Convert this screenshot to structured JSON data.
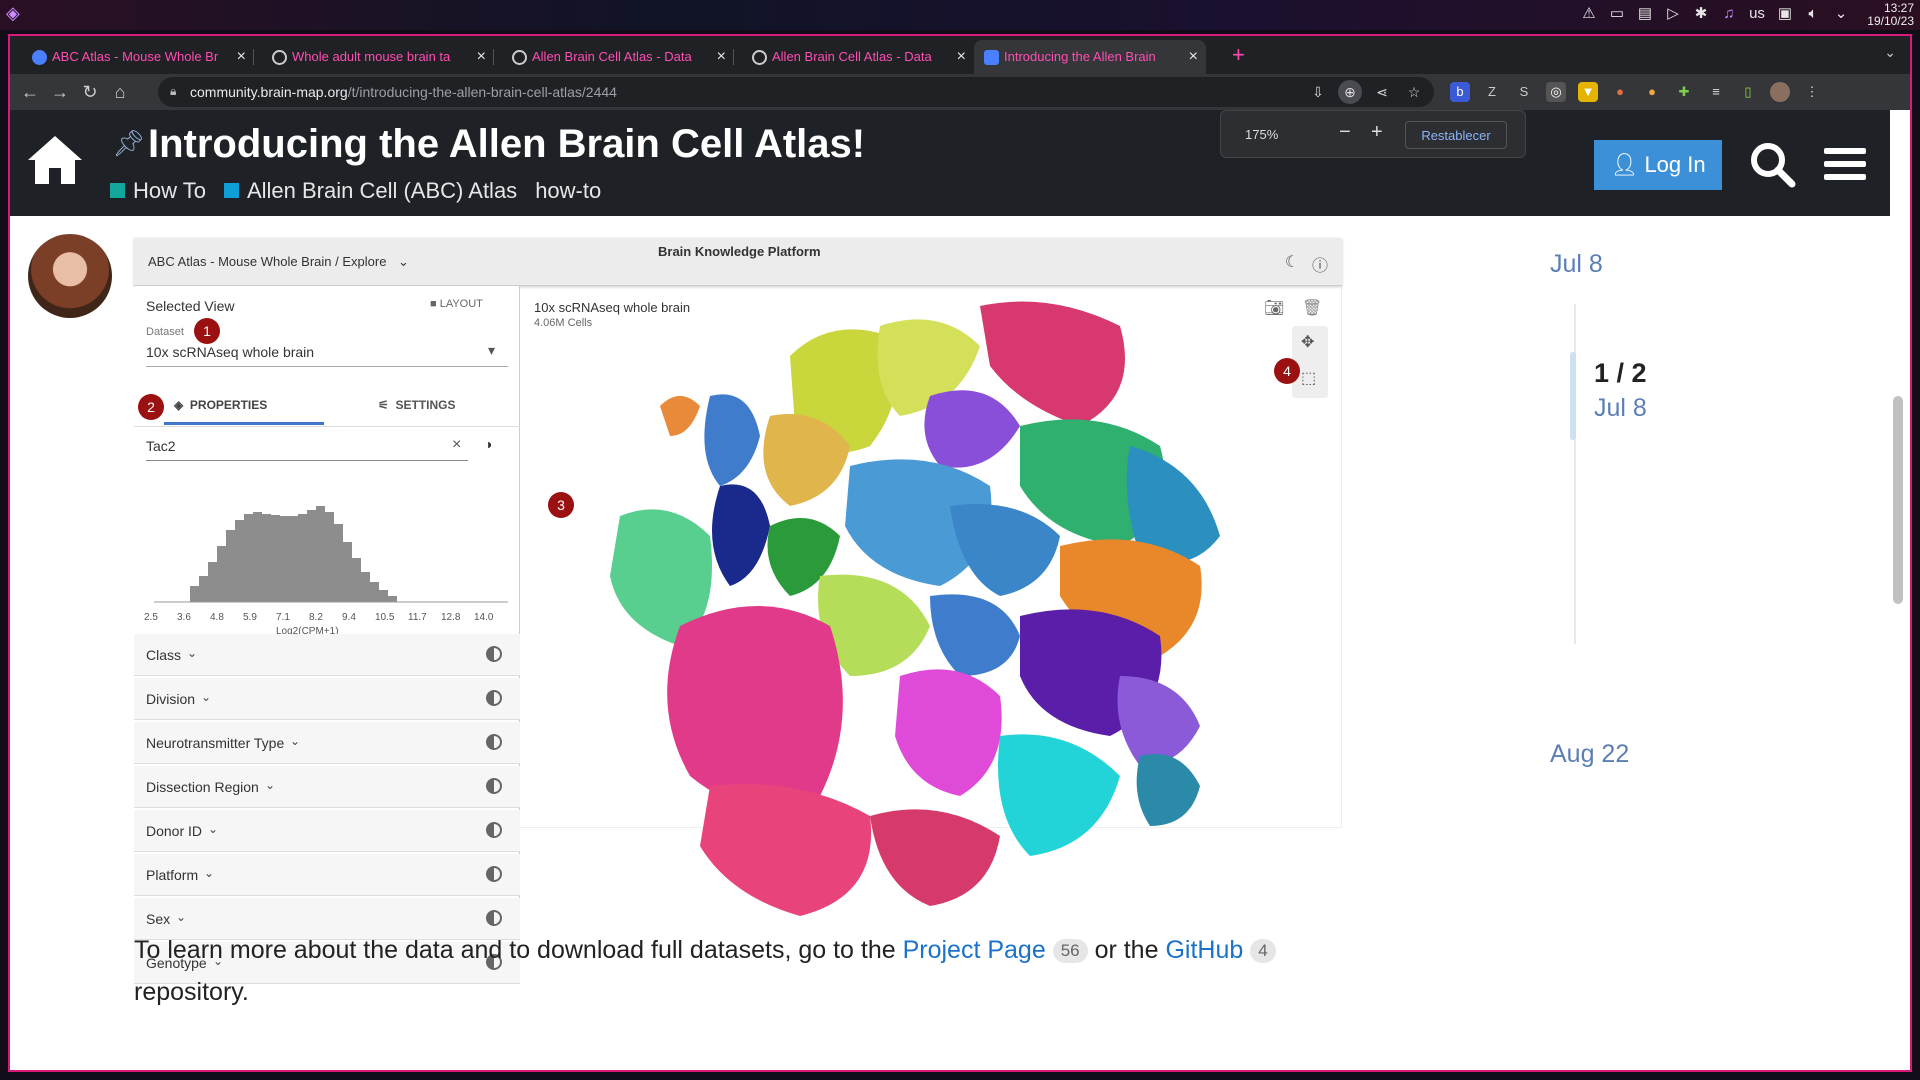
{
  "os": {
    "tray_lang": "us",
    "clock_time": "13:27",
    "clock_date": "19/10/23"
  },
  "browser": {
    "tabs": [
      {
        "label": "ABC Atlas - Mouse Whole Br"
      },
      {
        "label": "Whole adult mouse brain ta"
      },
      {
        "label": "Allen Brain Cell Atlas - Data"
      },
      {
        "label": "Allen Brain Cell Atlas - Data"
      },
      {
        "label": "Introducing the Allen Brain"
      }
    ],
    "url_host": "community.brain-map.org",
    "url_path": "/t/introducing-the-allen-brain-cell-atlas/2444",
    "zoom": {
      "value": "175%",
      "minus": "−",
      "plus": "+",
      "reset": "Restablecer"
    }
  },
  "site": {
    "title": "Introducing the Allen Brain Cell Atlas!",
    "categories": [
      {
        "label": "How To",
        "color": "#12a89d"
      },
      {
        "label": "Allen Brain Cell (ABC) Atlas",
        "color": "#0e9fd6"
      },
      {
        "label": "how-to",
        "color": ""
      }
    ],
    "login": "Log In"
  },
  "embedded": {
    "breadcrumb": "ABC Atlas - Mouse Whole Brain  /  Explore",
    "platform_title": "Brain Knowledge Platform",
    "selected_view": "Selected View",
    "layout": "LAYOUT",
    "dataset_label": "Dataset",
    "dataset_value": "10x scRNAseq whole brain",
    "tab_properties": "PROPERTIES",
    "tab_settings": "SETTINGS",
    "gene": "Tac2",
    "histogram": {
      "ticks": [
        "2.5",
        "3.6",
        "4.8",
        "5.9",
        "7.1",
        "8.2",
        "9.4",
        "10.5",
        "11.7",
        "12.8",
        "14.0"
      ],
      "xlabel": "Log2(CPM+1)"
    },
    "properties": [
      "Class",
      "Division",
      "Neurotransmitter Type",
      "Dissection Region",
      "Donor ID",
      "Platform",
      "Sex",
      "Genotype"
    ],
    "badges": [
      "1",
      "2",
      "3",
      "4"
    ],
    "umap_title": "10x scRNAseq whole brain",
    "umap_cells": "4.06M Cells"
  },
  "post": {
    "text_before": "To learn more about the data and to download full datasets, go to the",
    "link1": "Project Page",
    "link1_count": "56",
    "text_mid": "or the",
    "link2": "GitHub",
    "link2_count": "4",
    "text_cont": "repository."
  },
  "timeline": {
    "top_date": "Jul 8",
    "position": "1 / 2",
    "pos_date": "Jul 8",
    "bottom_date": "Aug 22"
  }
}
